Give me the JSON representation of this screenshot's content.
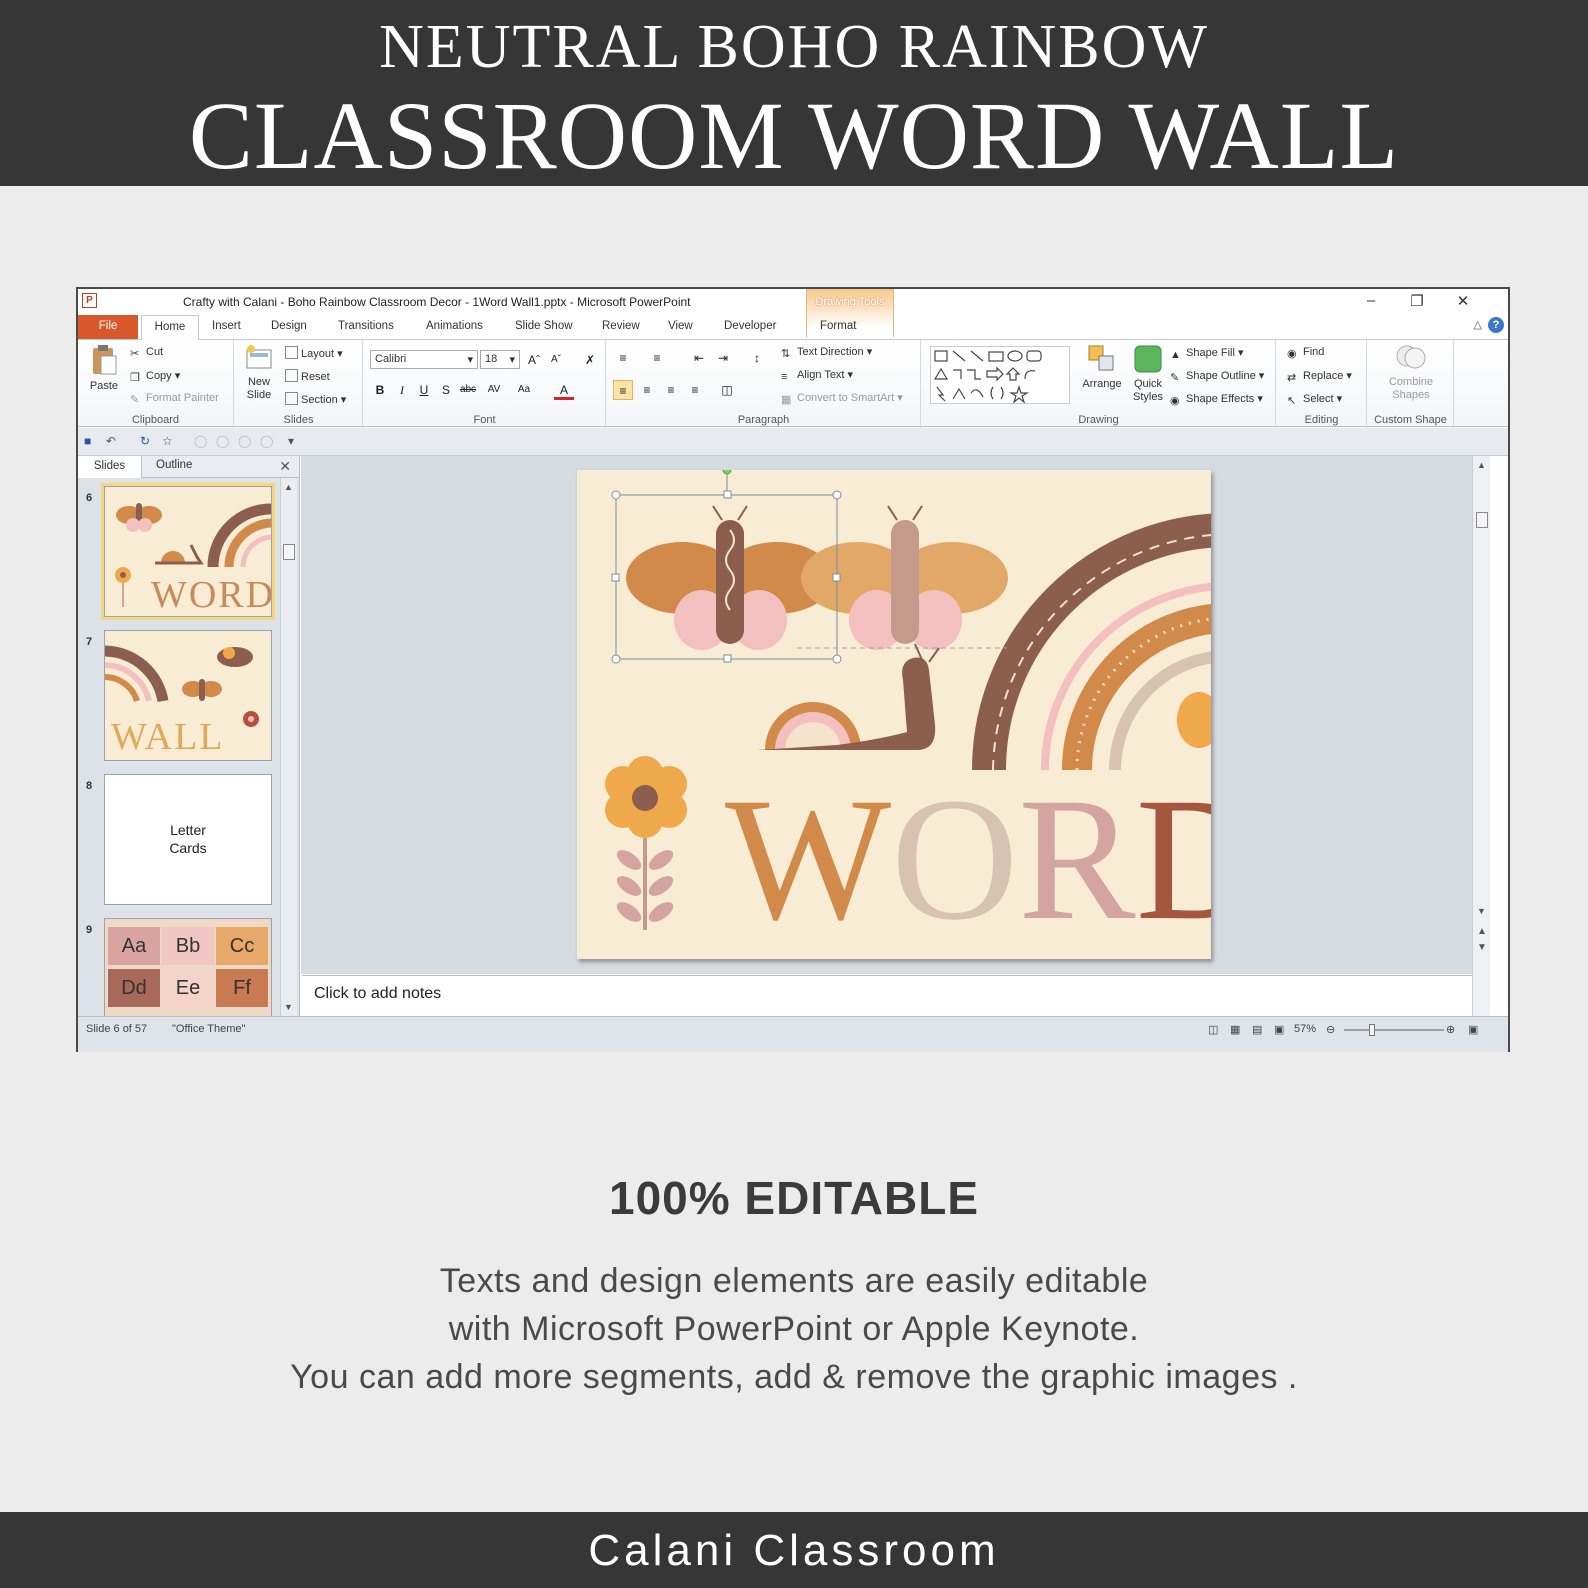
{
  "header": {
    "line1": "NEUTRAL BOHO RAINBOW",
    "line2": "CLASSROOM WORD WALL"
  },
  "window": {
    "title": "Crafty with Calani - Boho Rainbow Classroom Decor - 1Word Wall1.pptx  -  Microsoft PowerPoint",
    "context_group": "Drawing Tools",
    "controls": [
      "minimize",
      "restore",
      "close"
    ]
  },
  "tabs": [
    "File",
    "Home",
    "Insert",
    "Design",
    "Transitions",
    "Animations",
    "Slide Show",
    "Review",
    "View",
    "Developer",
    "Format"
  ],
  "ribbon": {
    "clipboard": {
      "paste": "Paste",
      "cut": "Cut",
      "copy": "Copy",
      "format_painter": "Format Painter",
      "label": "Clipboard"
    },
    "slides": {
      "new_slide_1": "New",
      "new_slide_2": "Slide",
      "layout": "Layout",
      "reset": "Reset",
      "section": "Section",
      "label": "Slides"
    },
    "font": {
      "font_name": "Calibri",
      "font_size": "18",
      "label": "Font"
    },
    "paragraph": {
      "text_direction": "Text Direction",
      "align_text": "Align Text",
      "convert": "Convert to SmartArt",
      "label": "Paragraph"
    },
    "drawing": {
      "arrange": "Arrange",
      "quick_1": "Quick",
      "quick_2": "Styles",
      "fill": "Shape Fill",
      "outline": "Shape Outline",
      "effects": "Shape Effects",
      "label": "Drawing"
    },
    "editing": {
      "find": "Find",
      "replace": "Replace",
      "select": "Select",
      "label": "Editing"
    },
    "custom": {
      "combine_1": "Combine",
      "combine_2": "Shapes",
      "label": "Custom Shape"
    }
  },
  "panel": {
    "tab_slides": "Slides",
    "tab_outline": "Outline",
    "thumbnails": [
      {
        "num": "6",
        "word": "WORD"
      },
      {
        "num": "7",
        "word": "WALL"
      },
      {
        "num": "8",
        "line1": "Letter",
        "line2": "Cards"
      },
      {
        "num": "9",
        "cells": [
          "Aa",
          "Bb",
          "Cc",
          "Dd",
          "Ee",
          "Ff"
        ]
      }
    ]
  },
  "slide": {
    "letters": [
      "W",
      "O",
      "R",
      "D"
    ]
  },
  "notes_placeholder": "Click to add notes",
  "status": {
    "slide_info": "Slide 6 of 57",
    "theme": "\"Office Theme\"",
    "zoom": "57%",
    "zoom_level": 0.57
  },
  "promo": {
    "title": "100% EDITABLE",
    "line1": "Texts and design elements are easily editable",
    "line2": "with Microsoft PowerPoint or Apple Keynote.",
    "line3": "You can add more segments, add & remove the graphic images ."
  },
  "footer": "Calani Classroom",
  "colors": {
    "header_bg": "#363636",
    "page_bg": "#ececec",
    "slide_bg": "#f8ecd5",
    "file_tab": "#d9582b",
    "letter_W": "#d18a4a",
    "letter_O": "#d8c2b2",
    "letter_R": "#d3a4a0",
    "letter_D": "#a4563f",
    "rainbow_brown": "#8b5e4e",
    "rainbow_orange": "#d1873c",
    "pink": "#f3bfbf"
  }
}
